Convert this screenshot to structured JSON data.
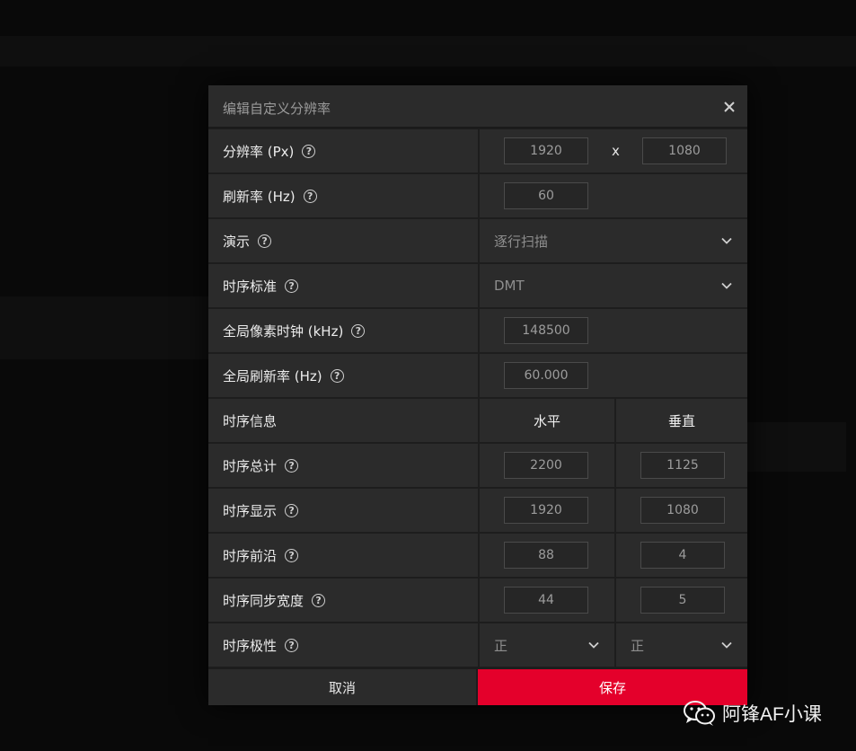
{
  "dialog": {
    "title": "编辑自定义分辨率",
    "close_icon": "close-icon"
  },
  "rows": {
    "resolution": {
      "label": "分辨率 (Px)",
      "width": "1920",
      "separator": "x",
      "height": "1080"
    },
    "refresh": {
      "label": "刷新率 (Hz)",
      "value": "60"
    },
    "presentation": {
      "label": "演示",
      "selected": "逐行扫描"
    },
    "timing_standard": {
      "label": "时序标准",
      "selected": "DMT"
    },
    "pixel_clock": {
      "label": "全局像素时钟 (kHz)",
      "value": "148500"
    },
    "global_refresh": {
      "label": "全局刷新率 (Hz)",
      "value": "60.000"
    },
    "timing_info": {
      "label": "时序信息",
      "col_horizontal": "水平",
      "col_vertical": "垂直"
    },
    "timing_total": {
      "label": "时序总计",
      "horizontal": "2200",
      "vertical": "1125"
    },
    "timing_display": {
      "label": "时序显示",
      "horizontal": "1920",
      "vertical": "1080"
    },
    "timing_front_porch": {
      "label": "时序前沿",
      "horizontal": "88",
      "vertical": "4"
    },
    "timing_sync_width": {
      "label": "时序同步宽度",
      "horizontal": "44",
      "vertical": "5"
    },
    "timing_polarity": {
      "label": "时序极性",
      "horizontal": "正",
      "vertical": "正"
    }
  },
  "footer": {
    "cancel": "取消",
    "save": "保存"
  },
  "help_glyph": "?",
  "watermark": {
    "text": "阿锋AF小课",
    "icon": "wechat-icon"
  },
  "colors": {
    "accent": "#e4002b",
    "panel": "#2b2b2b",
    "divider": "#1d1d1d"
  }
}
